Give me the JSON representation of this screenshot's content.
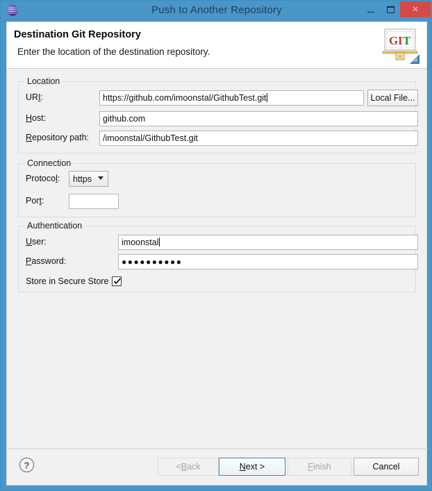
{
  "window": {
    "title": "Push to Another Repository",
    "app_icon": "eclipse-sphere-icon",
    "controls": {
      "minimize": "minimize-icon",
      "maximize": "restore-icon",
      "close": "×"
    },
    "accent_color": "#4a96c8",
    "close_color": "#d64a4a"
  },
  "header": {
    "title": "Destination Git Repository",
    "subtitle": "Enter the location of the destination repository.",
    "logo": "git-easel-logo",
    "logo_text": "GIT"
  },
  "location": {
    "group_title": "Location",
    "uri_label_pre": "UR",
    "uri_label_accel": "I",
    "uri_label_post": ":",
    "uri_value": "https://github.com/imoonstal/GithubTest.git",
    "local_file_button": "Local File...",
    "host_label_accel": "H",
    "host_label_post": "ost:",
    "host_value": "github.com",
    "repo_label_accel": "R",
    "repo_label_post": "epository path:",
    "repo_value": "/imoonstal/GithubTest.git"
  },
  "connection": {
    "group_title": "Connection",
    "protocol_label_pre": "Protoco",
    "protocol_label_accel": "l",
    "protocol_label_post": ":",
    "protocol_value": "https",
    "protocol_options": [
      "https"
    ],
    "port_label_pre": "Por",
    "port_label_accel": "t",
    "port_label_post": ":",
    "port_value": ""
  },
  "authentication": {
    "group_title": "Authentication",
    "user_label_accel": "U",
    "user_label_post": "ser:",
    "user_value": "imoonstal",
    "password_label_accel": "P",
    "password_label_post": "assword:",
    "password_value": "●●●●●●●●●●",
    "store_label": "Store in Secure Store",
    "store_checked": true
  },
  "footer": {
    "help": "help-icon",
    "back_pre": "< ",
    "back_accel": "B",
    "back_post": "ack",
    "next_accel": "N",
    "next_pre": "",
    "next_post": "ext >",
    "finish_accel": "F",
    "finish_post": "inish",
    "cancel": "Cancel",
    "back_enabled": false,
    "next_enabled": true,
    "finish_enabled": false,
    "cancel_enabled": true
  }
}
